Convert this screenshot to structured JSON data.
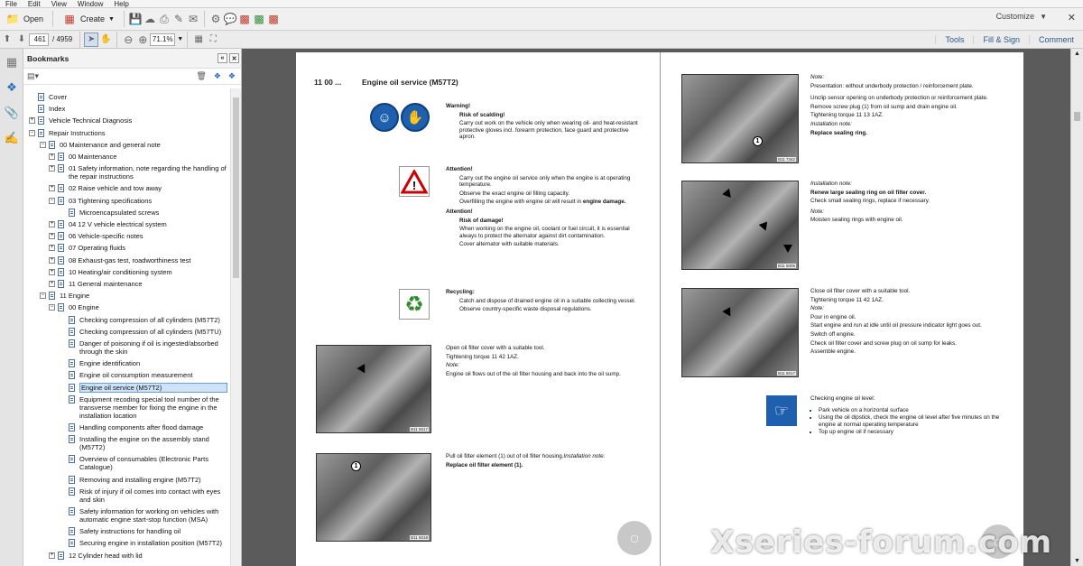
{
  "menu": [
    "File",
    "Edit",
    "View",
    "Window",
    "Help"
  ],
  "toolbar": {
    "open_label": "Open",
    "create_label": "Create",
    "customize_label": "Customize",
    "icons": [
      "save-icon",
      "cloud-icon",
      "print-icon",
      "edit-icon",
      "mail-icon",
      "gear-icon",
      "comment-icon",
      "pdf-icon",
      "export-icon",
      "pdf-edit-icon"
    ]
  },
  "nav": {
    "page_current": "461",
    "page_total": "/ 4959",
    "zoom": "71.1%",
    "links": [
      "Tools",
      "Fill & Sign",
      "Comment"
    ]
  },
  "bookmarks": {
    "title": "Bookmarks",
    "items": [
      {
        "label": "Cover",
        "level": 1,
        "toggle": ""
      },
      {
        "label": "Index",
        "level": 1,
        "toggle": ""
      },
      {
        "label": "Vehicle Technical Diagnosis",
        "level": 1,
        "toggle": "+"
      },
      {
        "label": "Repair Instructions",
        "level": 1,
        "toggle": "−"
      },
      {
        "label": "00 Maintenance and general note",
        "level": 2,
        "toggle": "−"
      },
      {
        "label": "00 Maintenance",
        "level": 3,
        "toggle": "+"
      },
      {
        "label": "01 Safety information, note regarding the handling of the repair instructions",
        "level": 3,
        "toggle": "+",
        "lines": 2
      },
      {
        "label": "02 Raise vehicle and tow away",
        "level": 3,
        "toggle": "+"
      },
      {
        "label": "03 Tightening specifications",
        "level": 3,
        "toggle": "−"
      },
      {
        "label": "Microencapsulated screws",
        "level": 4,
        "toggle": ""
      },
      {
        "label": "04 12 V vehicle electrical system",
        "level": 3,
        "toggle": "+"
      },
      {
        "label": "06 Vehicle-specific notes",
        "level": 3,
        "toggle": "+"
      },
      {
        "label": "07 Operating fluids",
        "level": 3,
        "toggle": "+"
      },
      {
        "label": "08 Exhaust-gas test, roadworthiness test",
        "level": 3,
        "toggle": "+"
      },
      {
        "label": "10 Heating/air conditioning system",
        "level": 3,
        "toggle": "+"
      },
      {
        "label": "11 General maintenance",
        "level": 3,
        "toggle": "+"
      },
      {
        "label": "11 Engine",
        "level": 2,
        "toggle": "−"
      },
      {
        "label": "00 Engine",
        "level": 3,
        "toggle": "−"
      },
      {
        "label": "Checking compression of all cylinders (M57T2)",
        "level": 4,
        "toggle": ""
      },
      {
        "label": "Checking compression of all cylinders (M57TU)",
        "level": 4,
        "toggle": ""
      },
      {
        "label": "Danger of poisoning if oil is ingested/absorbed through the skin",
        "level": 4,
        "toggle": "",
        "lines": 2
      },
      {
        "label": "Engine identification",
        "level": 4,
        "toggle": ""
      },
      {
        "label": "Engine oil consumption measurement",
        "level": 4,
        "toggle": ""
      },
      {
        "label": "Engine oil service (M57T2)",
        "level": 4,
        "toggle": "",
        "selected": true
      },
      {
        "label": "Equipment recoding special tool number of the transverse member for fixing the engine in the installation location",
        "level": 4,
        "toggle": "",
        "lines": 3
      },
      {
        "label": "Handling components after flood damage",
        "level": 4,
        "toggle": ""
      },
      {
        "label": "Installing the engine on the assembly stand (M57T2)",
        "level": 4,
        "toggle": "",
        "lines": 2
      },
      {
        "label": "Overview of consumables (Electronic Parts Catalogue)",
        "level": 4,
        "toggle": "",
        "lines": 2
      },
      {
        "label": "Removing and installing engine (M57T2)",
        "level": 4,
        "toggle": ""
      },
      {
        "label": "Risk of injury if oil comes into contact with eyes and skin",
        "level": 4,
        "toggle": "",
        "lines": 2
      },
      {
        "label": "Safety information for working on vehicles with automatic engine start-stop function (MSA)",
        "level": 4,
        "toggle": "",
        "lines": 2
      },
      {
        "label": "Safety instructions for handling oil",
        "level": 4,
        "toggle": ""
      },
      {
        "label": "Securing engine in installation position (M57T2)",
        "level": 4,
        "toggle": ""
      },
      {
        "label": "12 Cylinder head with lid",
        "level": 3,
        "toggle": "+"
      }
    ]
  },
  "doc": {
    "section_number": "11 00 ...",
    "title": "Engine oil service (M57T2)",
    "warning1": {
      "head": "Warning!",
      "sub": "Risk of scalding!",
      "body": "Carry out work on the vehicle only when wearing oil- and heat-resistant protective gloves incl. forearm protection, face guard and protective apron."
    },
    "attention1": {
      "head": "Attention!",
      "l1": "Carry out the engine oil service only when the engine is at operating temperature.",
      "l2": "Observe the exact engine oil filling capacity.",
      "l3a": "Overfilling the engine with engine oil will result in ",
      "l3b": "engine damage."
    },
    "attention2": {
      "head": "Attention!",
      "sub": "Risk of damage!",
      "l1": "When working on the engine oil, coolant or fuel circuit, it is essential always to protect the alternator against dirt contamination.",
      "l2": "Cover alternator with suitable materials."
    },
    "recycling": {
      "head": "Recycling:",
      "l1": "Catch and dispose of drained engine oil in a suitable collecting vessel.",
      "l2": "Observe country-specific waste disposal regulations."
    },
    "step1": {
      "l1": "Open oil filter cover with a suitable tool.",
      "l2": "Tightening torque 11 42 1AZ.",
      "note": "Note:",
      "l3": "Engine oil flows out of the oil filter housing and back into the oil sump."
    },
    "step2": {
      "l1": "Pull oil filter element (1) out of oil filter housing.",
      "inst": "Installation note:",
      "l2": "Replace oil filter element (1)."
    },
    "pic_refs": [
      "B11 6017",
      "B11 6018",
      "B11 7342",
      "B11 6006",
      "B11 6017"
    ],
    "right1": {
      "note": "Note:",
      "l1": "Presentation: without underbody protection / reinforcement plate.",
      "l2": "Unclip sensor opening on underbody protection or reinforcement plate.",
      "l3": "Remove screw plug (1) from oil sump and drain engine oil.",
      "l4": "Tightening torque 11 13 1AZ.",
      "inst": "Installation note:",
      "l5": "Replace sealing ring."
    },
    "right2": {
      "inst": "Installation note:",
      "l1": "Renew large sealing ring on oil filter cover.",
      "l2": "Check small sealing rings, replace if necessary.",
      "note": "Note:",
      "l3": "Moisten sealing rings with engine oil."
    },
    "right3": {
      "l1": "Close oil filter cover with a suitable tool.",
      "l2": "Tightening torque 11 42 1AZ.",
      "note": "Note:",
      "l3": "Pour in engine oil.",
      "l4": "Start engine and run at idle until oil pressure indicator light goes out.",
      "l5": "Switch off engine.",
      "l6": "Check oil filter cover and screw plug on oil sump for leaks.",
      "l7": "Assemble engine."
    },
    "right4": {
      "head": "Checking engine oil level:",
      "b1": "Park vehicle on a horizontal surface",
      "b2": "Using the oil dipstick, check the engine oil level after five minutes on the engine at normal operating temperature",
      "b3": "Top up engine oil if necessary"
    },
    "callout": "1"
  },
  "watermark": "Xseries-forum.com",
  "colors": {
    "accent": "#1e5fae",
    "selection": "#cfe3f7",
    "doc_bg": "#5b5b5b"
  }
}
